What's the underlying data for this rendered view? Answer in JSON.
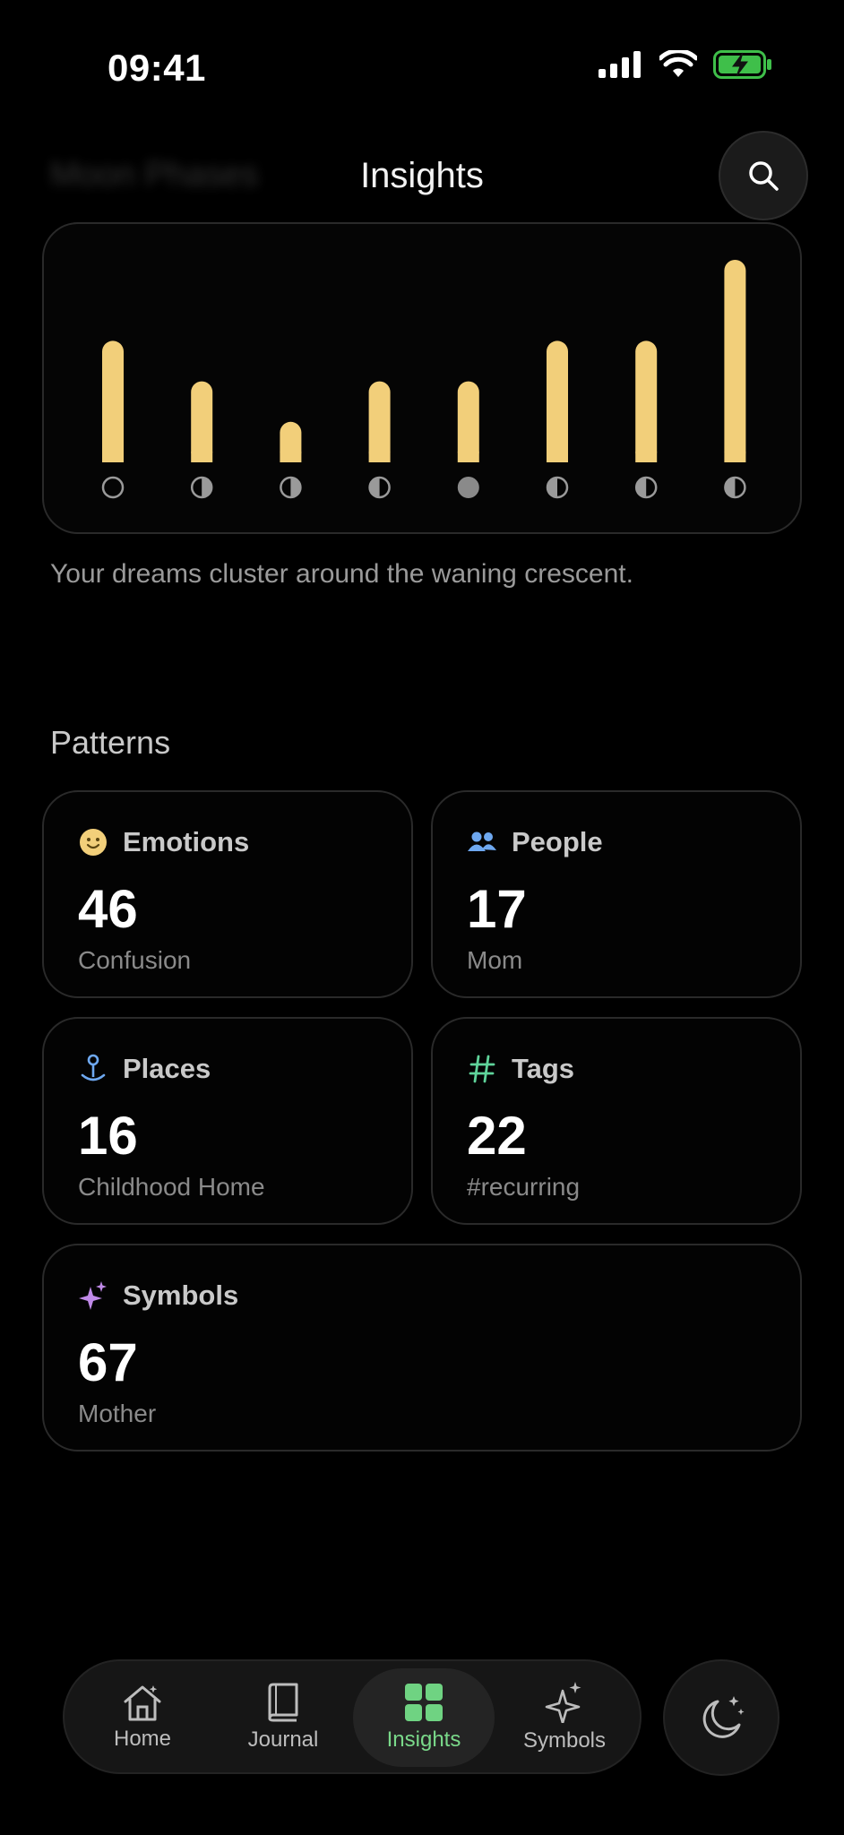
{
  "status": {
    "time": "09:41"
  },
  "header": {
    "ghost_title": "Moon Phases",
    "title": "Insights"
  },
  "chart_data": {
    "type": "bar",
    "title": "",
    "categories": [
      "new moon",
      "waxing crescent",
      "first quarter",
      "waxing gibbous",
      "full moon",
      "waning gibbous",
      "last quarter",
      "waning crescent"
    ],
    "values": [
      6,
      4,
      2,
      4,
      4,
      6,
      6,
      10
    ],
    "ylim": [
      0,
      10
    ],
    "grid": false,
    "bar_color": "#f2cf7a"
  },
  "insight": {
    "text": "Your dreams cluster around the waning crescent."
  },
  "patterns": {
    "title": "Patterns",
    "emotions": {
      "label": "Emotions",
      "count": "46",
      "top": "Confusion",
      "icon": "smiley-icon"
    },
    "people": {
      "label": "People",
      "count": "17",
      "top": "Mom",
      "icon": "people-icon"
    },
    "places": {
      "label": "Places",
      "count": "16",
      "top": "Childhood Home",
      "icon": "map-pin-icon"
    },
    "tags": {
      "label": "Tags",
      "count": "22",
      "top": "#recurring",
      "icon": "hashtag-icon"
    },
    "symbols": {
      "label": "Symbols",
      "count": "67",
      "top": "Mother",
      "icon": "sparkles-icon"
    }
  },
  "tabbar": {
    "home": "Home",
    "journal": "Journal",
    "insights": "Insights",
    "symbols": "Symbols",
    "active": "insights"
  },
  "colors": {
    "accent": "#7ad98a",
    "bar": "#f2cf7a",
    "people": "#6ea8f0",
    "tags": "#5fd39a",
    "symbols": "#c08ae8"
  }
}
